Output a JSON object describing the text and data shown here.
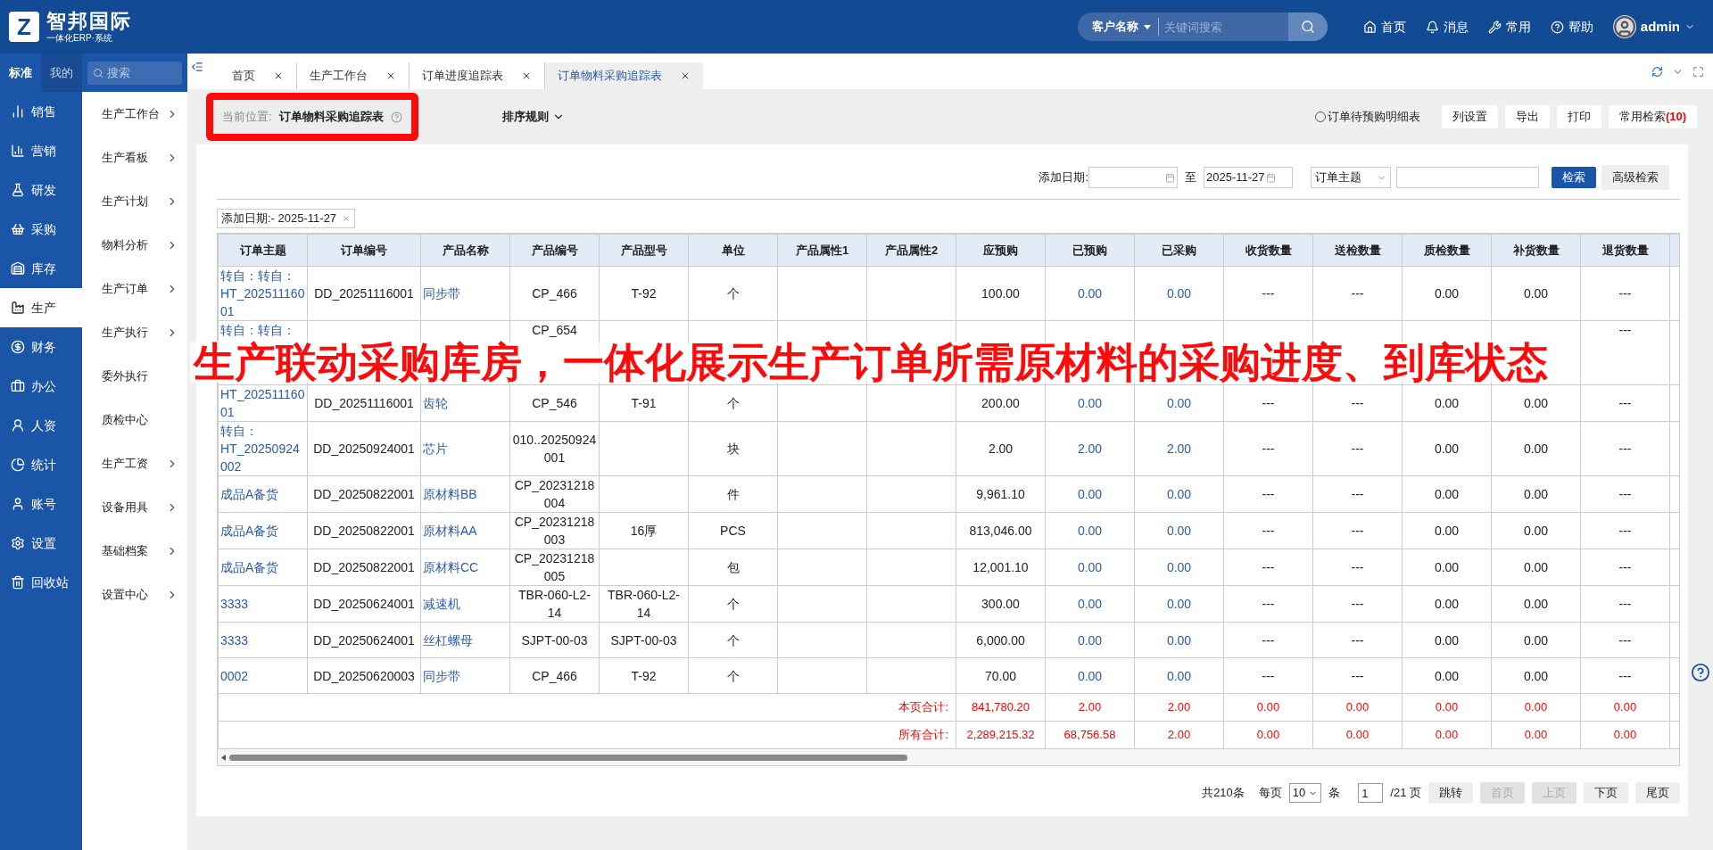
{
  "header": {
    "logo_mark": "Z",
    "logo_title": "智邦国际",
    "logo_subtitle": "一体化ERP·系统",
    "search_scope": "客户名称",
    "search_placeholder": "关键词搜索",
    "nav": [
      {
        "kind": "home",
        "label": "首页"
      },
      {
        "kind": "bell",
        "label": "消息"
      },
      {
        "kind": "wrench",
        "label": "常用"
      },
      {
        "kind": "help",
        "label": "帮助"
      }
    ],
    "user": "admin"
  },
  "sidebar": {
    "tabs": [
      {
        "label": "标准",
        "selected": true
      },
      {
        "label": "我的",
        "selected": false
      }
    ],
    "search_placeholder": "搜索",
    "items": [
      {
        "kind": "sales",
        "label": "销售",
        "selected": false
      },
      {
        "kind": "marketing",
        "label": "营销",
        "selected": false
      },
      {
        "kind": "rnd",
        "label": "研发",
        "selected": false
      },
      {
        "kind": "purchase",
        "label": "采购",
        "selected": false
      },
      {
        "kind": "stock",
        "label": "库存",
        "selected": false
      },
      {
        "kind": "production",
        "label": "生产",
        "selected": true
      },
      {
        "kind": "finance",
        "label": "财务",
        "selected": false
      },
      {
        "kind": "office",
        "label": "办公",
        "selected": false
      },
      {
        "kind": "hr",
        "label": "人资",
        "selected": false
      },
      {
        "kind": "stats",
        "label": "统计",
        "selected": false
      },
      {
        "kind": "account",
        "label": "账号",
        "selected": false
      },
      {
        "kind": "settings",
        "label": "设置",
        "selected": false
      },
      {
        "kind": "trash",
        "label": "回收站",
        "selected": false
      }
    ]
  },
  "submenu": [
    {
      "label": "生产工作台",
      "chevron": true
    },
    {
      "label": "生产看板",
      "chevron": true
    },
    {
      "label": "生产计划",
      "chevron": true
    },
    {
      "label": "物料分析",
      "chevron": true
    },
    {
      "label": "生产订单",
      "chevron": true
    },
    {
      "label": "生产执行",
      "chevron": true
    },
    {
      "label": "委外执行",
      "chevron": false
    },
    {
      "label": "质检中心",
      "chevron": false
    },
    {
      "label": "生产工资",
      "chevron": true
    },
    {
      "label": "设备用具",
      "chevron": true
    },
    {
      "label": "基础档案",
      "chevron": true
    },
    {
      "label": "设置中心",
      "chevron": true
    }
  ],
  "tabs": [
    {
      "label": "首页",
      "selected": false
    },
    {
      "label": "生产工作台",
      "selected": false
    },
    {
      "label": "订单进度追踪表",
      "selected": false
    },
    {
      "label": "订单物料采购追踪表",
      "selected": true
    }
  ],
  "breadcrumb": {
    "label": "当前位置:",
    "current": "订单物料采购追踪表",
    "highlighted": true
  },
  "sort_label": "排序规则",
  "toolbar": {
    "radio": {
      "label": "订单待预购明细表",
      "selected": false
    },
    "buttons": [
      "列设置",
      "导出",
      "打印"
    ],
    "saved_search": {
      "label": "常用检索",
      "count": "(10)"
    }
  },
  "filter": {
    "date_label": "添加日期:",
    "to_label": "至",
    "date_to": "2025-11-27",
    "field": "订单主题",
    "search_button": "检索",
    "advanced_button": "高级检索"
  },
  "chip": "添加日期:- 2025-11-27",
  "table": {
    "columns": [
      {
        "label": "订单主题",
        "kind": "link"
      },
      {
        "label": "订单编号",
        "kind": "text"
      },
      {
        "label": "产品名称",
        "kind": "link"
      },
      {
        "label": "产品编号",
        "kind": "text"
      },
      {
        "label": "产品型号",
        "kind": "text"
      },
      {
        "label": "单位",
        "kind": "text"
      },
      {
        "label": "产品属性1",
        "kind": "text"
      },
      {
        "label": "产品属性2",
        "kind": "text"
      },
      {
        "label": "应预购",
        "kind": "text"
      },
      {
        "label": "已预购",
        "kind": "link"
      },
      {
        "label": "已采购",
        "kind": "link"
      },
      {
        "label": "收货数量",
        "kind": "text"
      },
      {
        "label": "送检数量",
        "kind": "text"
      },
      {
        "label": "质检数量",
        "kind": "text"
      },
      {
        "label": "补货数量",
        "kind": "text"
      },
      {
        "label": "退货数量",
        "kind": "text"
      }
    ],
    "rows": [
      [
        "转自：转自：HT_20251116001",
        "DD_20251116001",
        "同步带",
        "CP_466",
        "T-92",
        "个",
        null,
        null,
        "100.00",
        "0.00",
        "0.00",
        "---",
        "---",
        "0.00",
        "0.00",
        "---"
      ],
      [
        "转自：转自：",
        null,
        null,
        "CP_654",
        null,
        null,
        null,
        null,
        null,
        null,
        null,
        null,
        null,
        null,
        null,
        "---"
      ],
      [
        "HT_20251116001",
        "DD_20251116001",
        "齿轮",
        "CP_546",
        "T-91",
        "个",
        null,
        null,
        "200.00",
        "0.00",
        "0.00",
        "---",
        "---",
        "0.00",
        "0.00",
        "---"
      ],
      [
        "转自：HT_20250924002",
        "DD_20250924001",
        "芯片",
        "010..20250924001",
        null,
        "块",
        null,
        null,
        "2.00",
        "2.00",
        "2.00",
        "---",
        "---",
        "0.00",
        "0.00",
        "---"
      ],
      [
        "成品A备货",
        "DD_20250822001",
        "原材料BB",
        "CP_20231218004",
        null,
        "件",
        null,
        null,
        "9,961.10",
        "0.00",
        "0.00",
        "---",
        "---",
        "0.00",
        "0.00",
        "---"
      ],
      [
        "成品A备货",
        "DD_20250822001",
        "原材料AA",
        "CP_20231218003",
        "16厚",
        "PCS",
        null,
        null,
        "813,046.00",
        "0.00",
        "0.00",
        "---",
        "---",
        "0.00",
        "0.00",
        "---"
      ],
      [
        "成品A备货",
        "DD_20250822001",
        "原材料CC",
        "CP_20231218005",
        null,
        "包",
        null,
        null,
        "12,001.10",
        "0.00",
        "0.00",
        "---",
        "---",
        "0.00",
        "0.00",
        "---"
      ],
      [
        "3333",
        "DD_20250624001",
        "减速机",
        "TBR-060-L2-14",
        "TBR-060-L2-14",
        "个",
        null,
        null,
        "300.00",
        "0.00",
        "0.00",
        "---",
        "---",
        "0.00",
        "0.00",
        "---"
      ],
      [
        "3333",
        "DD_20250624001",
        "丝杠螺母",
        "SJPT-00-03",
        "SJPT-00-03",
        "个",
        null,
        null,
        "6,000.00",
        "0.00",
        "0.00",
        "---",
        "---",
        "0.00",
        "0.00",
        "---"
      ],
      [
        "0002",
        "DD_20250620003",
        "同步带",
        "CP_466",
        "T-92",
        "个",
        null,
        null,
        "70.00",
        "0.00",
        "0.00",
        "---",
        "---",
        "0.00",
        "0.00",
        "---"
      ]
    ],
    "totals": [
      {
        "label": "本页合计:",
        "values": [
          "841,780.20",
          "2.00",
          "2.00",
          "0.00",
          "0.00",
          "0.00",
          "0.00",
          "0.00"
        ]
      },
      {
        "label": "所有合计:",
        "values": [
          "2,289,215.32",
          "68,756.58",
          "2.00",
          "0.00",
          "0.00",
          "0.00",
          "0.00",
          "0.00"
        ]
      }
    ]
  },
  "pagination": {
    "total": "共210条",
    "per_page_label": "每页",
    "per_page": "10",
    "unit": "条",
    "page": "1",
    "pages": "/21 页",
    "buttons": [
      {
        "label": "跳转",
        "disabled": false
      },
      {
        "label": "首页",
        "disabled": true
      },
      {
        "label": "上页",
        "disabled": true
      },
      {
        "label": "下页",
        "disabled": false
      },
      {
        "label": "尾页",
        "disabled": false
      }
    ]
  },
  "caption": "生产联动采购库房，一体化展示生产订单所需原材料的采购进度、到库状态"
}
